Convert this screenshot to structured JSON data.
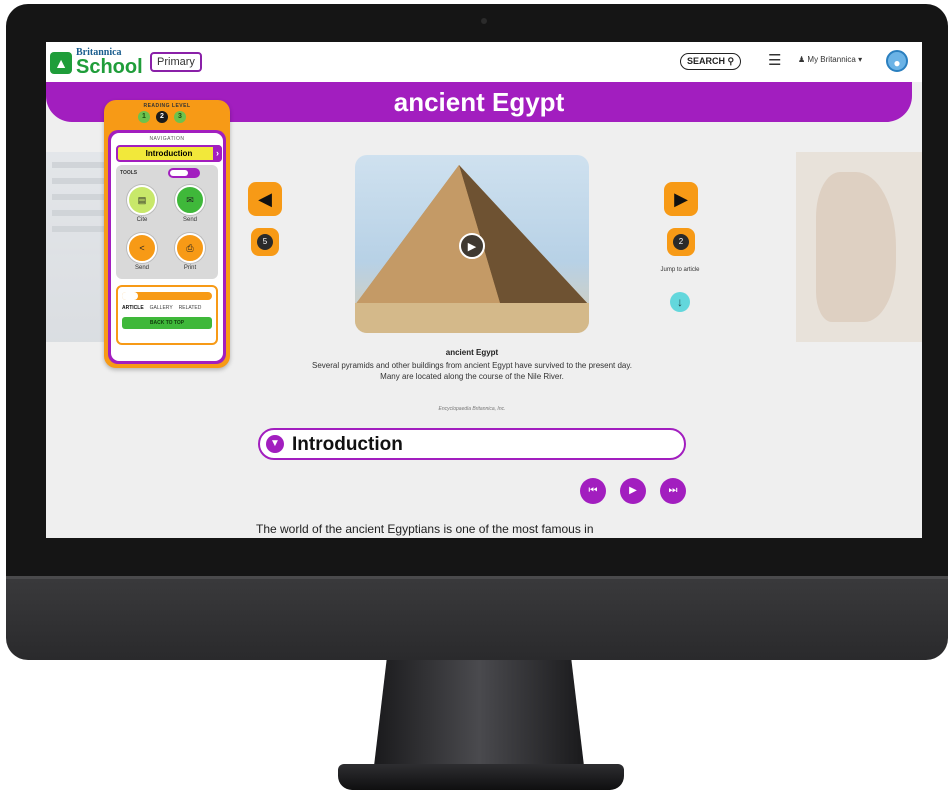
{
  "brand": {
    "line1": "Britannica",
    "line2": "School",
    "edition": "Primary"
  },
  "header": {
    "search_label": "SEARCH",
    "search_icon": "magnifier",
    "menu_icon": "hamburger",
    "account_label": "My Britannica",
    "globe_icon": "globe"
  },
  "article": {
    "title": "ancient Egypt",
    "reading_level_label": "READING LEVEL",
    "reading_levels": [
      "1",
      "2",
      "3"
    ],
    "selected_level": "2",
    "navigation_label": "NAVIGATION",
    "current_section": "Introduction",
    "tools_label": "TOOLS",
    "tools": [
      {
        "label": "Cite",
        "icon": "cite",
        "color": "#c8e86a"
      },
      {
        "label": "Send",
        "icon": "email",
        "color": "#3fb83a"
      },
      {
        "label": "Send",
        "icon": "share",
        "color": "#f79a16"
      },
      {
        "label": "Print",
        "icon": "print",
        "color": "#f79a16"
      }
    ],
    "tabs": [
      "ARTICLE",
      "GALLERY",
      "RELATED"
    ],
    "back_to_top": "BACK TO TOP",
    "prev_count": "5",
    "next_count": "2",
    "jump_label": "Jump to article",
    "media": {
      "caption_title": "ancient Egypt",
      "caption": "Several pyramids and other buildings from ancient Egypt have survived to the present day. Many are located along the course of the Nile River.",
      "credit": "Encyclopaedia Britannica, Inc."
    },
    "section_title": "Introduction",
    "body_first_line": "The world of the ancient Egyptians is one of the most famous in"
  },
  "colors": {
    "accent_purple": "#a21ebf",
    "accent_orange": "#f79a16",
    "brand_green": "#1f9d3a"
  }
}
